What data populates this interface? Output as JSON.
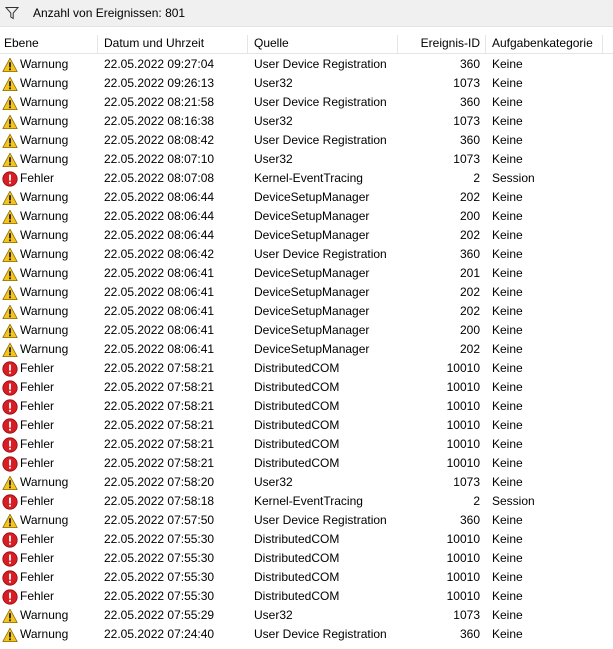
{
  "filter": {
    "label": "Anzahl von Ereignissen: 801",
    "icon": "filter-icon"
  },
  "columns": {
    "level": "Ebene",
    "date": "Datum und Uhrzeit",
    "source": "Quelle",
    "id": "Ereignis-ID",
    "category": "Aufgabenkategorie"
  },
  "icons": {
    "warning": "warning-icon",
    "error": "error-icon"
  },
  "colors": {
    "warning": "#f6c51a",
    "error": "#d81e23",
    "headerbar": "#f0f0f0"
  },
  "events": [
    {
      "type": "warning",
      "level": "Warnung",
      "date": "22.05.2022 09:27:04",
      "source": "User Device Registration",
      "id": "360",
      "category": "Keine"
    },
    {
      "type": "warning",
      "level": "Warnung",
      "date": "22.05.2022 09:26:13",
      "source": "User32",
      "id": "1073",
      "category": "Keine"
    },
    {
      "type": "warning",
      "level": "Warnung",
      "date": "22.05.2022 08:21:58",
      "source": "User Device Registration",
      "id": "360",
      "category": "Keine"
    },
    {
      "type": "warning",
      "level": "Warnung",
      "date": "22.05.2022 08:16:38",
      "source": "User32",
      "id": "1073",
      "category": "Keine"
    },
    {
      "type": "warning",
      "level": "Warnung",
      "date": "22.05.2022 08:08:42",
      "source": "User Device Registration",
      "id": "360",
      "category": "Keine"
    },
    {
      "type": "warning",
      "level": "Warnung",
      "date": "22.05.2022 08:07:10",
      "source": "User32",
      "id": "1073",
      "category": "Keine"
    },
    {
      "type": "error",
      "level": "Fehler",
      "date": "22.05.2022 08:07:08",
      "source": "Kernel-EventTracing",
      "id": "2",
      "category": "Session"
    },
    {
      "type": "warning",
      "level": "Warnung",
      "date": "22.05.2022 08:06:44",
      "source": "DeviceSetupManager",
      "id": "202",
      "category": "Keine"
    },
    {
      "type": "warning",
      "level": "Warnung",
      "date": "22.05.2022 08:06:44",
      "source": "DeviceSetupManager",
      "id": "200",
      "category": "Keine"
    },
    {
      "type": "warning",
      "level": "Warnung",
      "date": "22.05.2022 08:06:44",
      "source": "DeviceSetupManager",
      "id": "202",
      "category": "Keine"
    },
    {
      "type": "warning",
      "level": "Warnung",
      "date": "22.05.2022 08:06:42",
      "source": "User Device Registration",
      "id": "360",
      "category": "Keine"
    },
    {
      "type": "warning",
      "level": "Warnung",
      "date": "22.05.2022 08:06:41",
      "source": "DeviceSetupManager",
      "id": "201",
      "category": "Keine"
    },
    {
      "type": "warning",
      "level": "Warnung",
      "date": "22.05.2022 08:06:41",
      "source": "DeviceSetupManager",
      "id": "202",
      "category": "Keine"
    },
    {
      "type": "warning",
      "level": "Warnung",
      "date": "22.05.2022 08:06:41",
      "source": "DeviceSetupManager",
      "id": "202",
      "category": "Keine"
    },
    {
      "type": "warning",
      "level": "Warnung",
      "date": "22.05.2022 08:06:41",
      "source": "DeviceSetupManager",
      "id": "200",
      "category": "Keine"
    },
    {
      "type": "warning",
      "level": "Warnung",
      "date": "22.05.2022 08:06:41",
      "source": "DeviceSetupManager",
      "id": "202",
      "category": "Keine"
    },
    {
      "type": "error",
      "level": "Fehler",
      "date": "22.05.2022 07:58:21",
      "source": "DistributedCOM",
      "id": "10010",
      "category": "Keine"
    },
    {
      "type": "error",
      "level": "Fehler",
      "date": "22.05.2022 07:58:21",
      "source": "DistributedCOM",
      "id": "10010",
      "category": "Keine"
    },
    {
      "type": "error",
      "level": "Fehler",
      "date": "22.05.2022 07:58:21",
      "source": "DistributedCOM",
      "id": "10010",
      "category": "Keine"
    },
    {
      "type": "error",
      "level": "Fehler",
      "date": "22.05.2022 07:58:21",
      "source": "DistributedCOM",
      "id": "10010",
      "category": "Keine"
    },
    {
      "type": "error",
      "level": "Fehler",
      "date": "22.05.2022 07:58:21",
      "source": "DistributedCOM",
      "id": "10010",
      "category": "Keine"
    },
    {
      "type": "error",
      "level": "Fehler",
      "date": "22.05.2022 07:58:21",
      "source": "DistributedCOM",
      "id": "10010",
      "category": "Keine"
    },
    {
      "type": "warning",
      "level": "Warnung",
      "date": "22.05.2022 07:58:20",
      "source": "User32",
      "id": "1073",
      "category": "Keine"
    },
    {
      "type": "error",
      "level": "Fehler",
      "date": "22.05.2022 07:58:18",
      "source": "Kernel-EventTracing",
      "id": "2",
      "category": "Session"
    },
    {
      "type": "warning",
      "level": "Warnung",
      "date": "22.05.2022 07:57:50",
      "source": "User Device Registration",
      "id": "360",
      "category": "Keine"
    },
    {
      "type": "error",
      "level": "Fehler",
      "date": "22.05.2022 07:55:30",
      "source": "DistributedCOM",
      "id": "10010",
      "category": "Keine"
    },
    {
      "type": "error",
      "level": "Fehler",
      "date": "22.05.2022 07:55:30",
      "source": "DistributedCOM",
      "id": "10010",
      "category": "Keine"
    },
    {
      "type": "error",
      "level": "Fehler",
      "date": "22.05.2022 07:55:30",
      "source": "DistributedCOM",
      "id": "10010",
      "category": "Keine"
    },
    {
      "type": "error",
      "level": "Fehler",
      "date": "22.05.2022 07:55:30",
      "source": "DistributedCOM",
      "id": "10010",
      "category": "Keine"
    },
    {
      "type": "warning",
      "level": "Warnung",
      "date": "22.05.2022 07:55:29",
      "source": "User32",
      "id": "1073",
      "category": "Keine"
    },
    {
      "type": "warning",
      "level": "Warnung",
      "date": "22.05.2022 07:24:40",
      "source": "User Device Registration",
      "id": "360",
      "category": "Keine"
    }
  ]
}
